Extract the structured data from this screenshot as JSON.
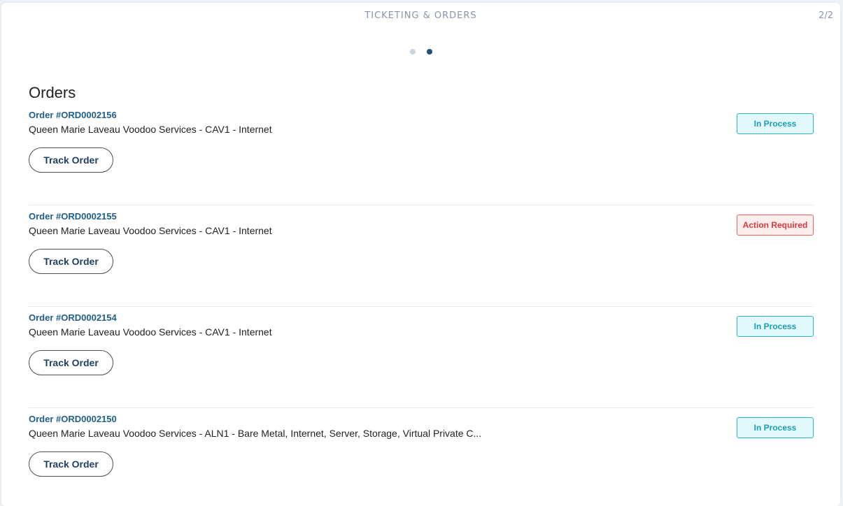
{
  "header": {
    "title": "TICKETING & ORDERS",
    "page_count": "2/2"
  },
  "pagination": {
    "dots": 2,
    "active_index": 1
  },
  "section": {
    "title": "Orders"
  },
  "orders": [
    {
      "id": "Order #ORD0002156",
      "description": "Queen Marie Laveau Voodoo Services - CAV1 - Internet",
      "status": "In Process",
      "status_type": "in-process",
      "button_label": "Track Order"
    },
    {
      "id": "Order #ORD0002155",
      "description": "Queen Marie Laveau Voodoo Services - CAV1 - Internet",
      "status": "Action Required",
      "status_type": "action-required",
      "button_label": "Track Order"
    },
    {
      "id": "Order #ORD0002154",
      "description": "Queen Marie Laveau Voodoo Services - CAV1 - Internet",
      "status": "In Process",
      "status_type": "in-process",
      "button_label": "Track Order"
    },
    {
      "id": "Order #ORD0002150",
      "description": "Queen Marie Laveau Voodoo Services - ALN1 - Bare Metal, Internet, Server, Storage, Virtual Private C...",
      "status": "In Process",
      "status_type": "in-process",
      "button_label": "Track Order"
    }
  ],
  "colors": {
    "accent": "#1f5f8b",
    "in_process": "#1aa0b3",
    "action_required": "#d9393d"
  }
}
